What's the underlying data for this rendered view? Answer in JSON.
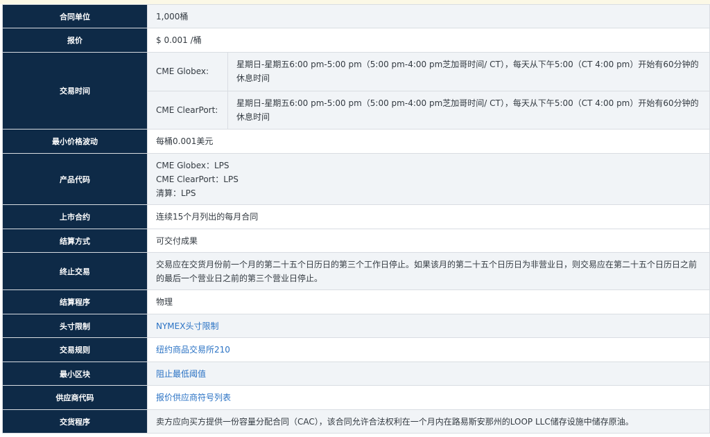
{
  "rows": {
    "contract_unit": {
      "label": "合同单位",
      "value": "1,000桶"
    },
    "price_quotation": {
      "label": "报价",
      "value": "$ 0.001 /桶"
    },
    "trading_hours": {
      "label": "交易时间",
      "globex_label": "CME Globex:",
      "globex_value": "星期日-星期五6:00 pm-5:00 pm（5:00 pm-4:00 pm芝加哥时间/ CT），每天从下午5:00（CT 4:00 pm）开始有60分钟的休息时间",
      "clearport_label": "CME ClearPort:",
      "clearport_value": "星期日-星期五6:00 pm-5:00 pm（5:00 pm-4:00 pm芝加哥时间/ CT），每天从下午5:00（CT 4:00 pm）开始有60分钟的休息时间"
    },
    "min_tick": {
      "label": "最小价格波动",
      "value": "每桶0.001美元"
    },
    "product_code": {
      "label": "产品代码",
      "line1": "CME Globex：LPS",
      "line2": "CME ClearPort：LPS",
      "line3": "清算：LPS"
    },
    "listed_contracts": {
      "label": "上市合约",
      "value": "连续15个月列出的每月合同"
    },
    "settlement_method": {
      "label": "结算方式",
      "value": "可交付成果"
    },
    "termination": {
      "label": "终止交易",
      "value": "交易应在交货月份前一个月的第二十五个日历日的第三个工作日停止。如果该月的第二十五个日历日为非营业日，则交易应在第二十五个日历日之前的最后一个营业日之前的第三个营业日停止。"
    },
    "settlement_procedure": {
      "label": "结算程序",
      "value": "物理"
    },
    "position_limits": {
      "label": "头寸限制",
      "value": "NYMEX头寸限制"
    },
    "rulebook": {
      "label": "交易规则",
      "value": "纽约商品交易所210"
    },
    "block_minimum": {
      "label": "最小区块",
      "value": "阻止最低阈值"
    },
    "vendor_codes": {
      "label": "供应商代码",
      "value": "报价供应商符号列表"
    },
    "delivery": {
      "label": "交货程序",
      "value": "卖方应向买方提供一份容量分配合同（CAC），该合同允许合法权利在一个月内在路易斯安那州的LOOP LLC储存设施中储存原油。"
    }
  },
  "colors": {
    "label_bg": "#0e2a47",
    "link": "#2a72c4",
    "alt_row": "#f1f4f7"
  }
}
